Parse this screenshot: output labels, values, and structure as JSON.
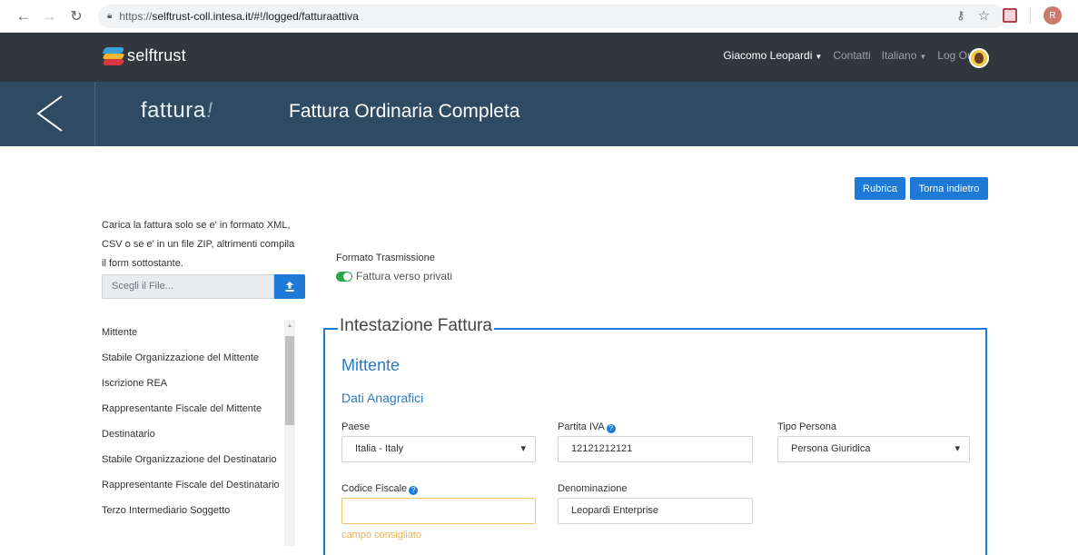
{
  "browser": {
    "url_scheme": "https://",
    "url_rest": "selftrust-coll.intesa.it/#!/logged/fatturaattiva",
    "profile_initial": "R"
  },
  "navbar": {
    "brand": "selftrust",
    "user": "Giacomo Leopardi",
    "contacts": "Contatti",
    "language": "Italiano",
    "logout": "Log Out"
  },
  "banner": {
    "logo_text": "fattura",
    "logo_mark": "!",
    "title": "Fattura Ordinaria Completa"
  },
  "actions": {
    "rubrica": "Rubrica",
    "torna": "Torna indietro"
  },
  "upload": {
    "hint_line1": "Carica la fattura solo se e' in formato XML,",
    "hint_line2": "CSV o se e' in un file ZIP, altrimenti compila",
    "hint_line3": "il form sottostante.",
    "file_placeholder": "Scegli il File..."
  },
  "sidebar": {
    "items": [
      {
        "label": "Mittente"
      },
      {
        "label": "Stabile Organizzazione del Mittente"
      },
      {
        "label": "Iscrizione REA"
      },
      {
        "label": "Rappresentante Fiscale del Mittente"
      },
      {
        "label": "Destinatario"
      },
      {
        "label": "Stabile Organizzazione del Destinatario"
      },
      {
        "label": "Rappresentante Fiscale del Destinatario"
      },
      {
        "label": "Terzo Intermediario Soggetto"
      }
    ]
  },
  "formato": {
    "label": "Formato Trasmissione",
    "toggle_label": "Fattura verso privati",
    "toggle_on": true
  },
  "form": {
    "legend": "Intestazione Fattura",
    "section": "Mittente",
    "subsection": "Dati Anagrafici",
    "paese_label": "Paese",
    "paese_value": "Italia - Italy",
    "piva_label": "Partita IVA",
    "piva_value": "12121212121",
    "tipo_label": "Tipo Persona",
    "tipo_value": "Persona Giuridica",
    "cf_label": "Codice Fiscale",
    "cf_value": "",
    "cf_hint": "campo consigliato",
    "denominazione_label": "Denominazione",
    "denominazione_value": "Leopardi Enterprise"
  },
  "colors": {
    "navbar": "#32373d",
    "banner": "#2f4b63",
    "primary": "#1e7ad6",
    "toggle": "#28a745",
    "warning": "#f0c36d"
  }
}
